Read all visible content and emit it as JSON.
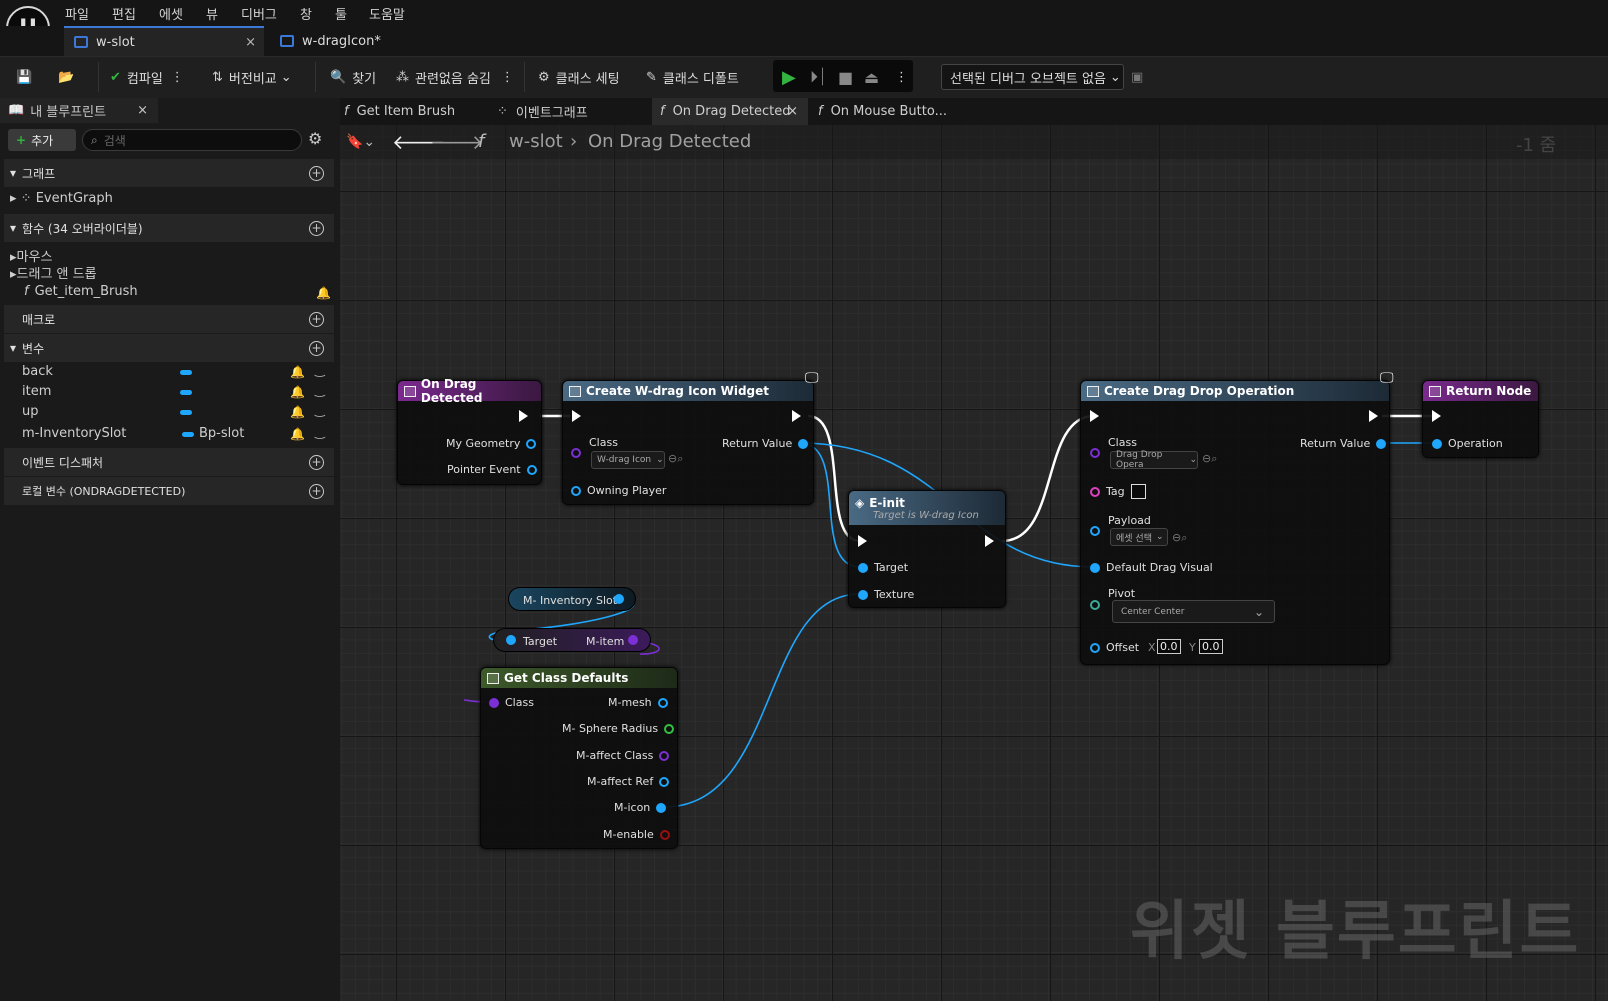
{
  "menu": [
    "파일",
    "편집",
    "에셋",
    "뷰",
    "디버그",
    "창",
    "툴",
    "도움말"
  ],
  "tabs": [
    {
      "label": "w-slot",
      "close": "×"
    },
    {
      "label": "w-dragIcon*",
      "close": "×"
    }
  ],
  "toolbar": {
    "compile": "컴파일",
    "diff": "버전비교",
    "find": "찾기",
    "hide_unrelated": "관련없음 숨김",
    "class_settings": "클래스 세팅",
    "class_defaults": "클래스 디폴트",
    "debug_object": "선택된 디버그 오브젝트 없음"
  },
  "left_panel": {
    "title": "내 블루프린트",
    "add": "추가",
    "search_placeholder": "검색",
    "sections": {
      "graph": "그래프",
      "functions": "함수 (34 오버라이더블)",
      "macros": "매크로",
      "variables": "변수",
      "dispatchers": "이벤트 디스패처",
      "locals": "로컬 변수 (ONDRAGDETECTED)"
    },
    "event_graph": "EventGraph",
    "func_mouse": "마우스",
    "func_dragdrop": "드래그 앤 드롭",
    "func_brush": "Get_item_Brush",
    "variables": [
      {
        "name": "back",
        "type": ""
      },
      {
        "name": "item",
        "type": ""
      },
      {
        "name": "up",
        "type": ""
      },
      {
        "name": "m-InventorySlot",
        "type": "Bp-slot"
      }
    ]
  },
  "graph_tabs": [
    "Get Item Brush",
    "이벤트그래프",
    "On Drag Detected",
    "On Mouse Butto..."
  ],
  "breadcrumb": {
    "root": "w-slot",
    "current": "On Drag Detected",
    "zoom": "-1 줌"
  },
  "nodes": {
    "on_drag": {
      "title": "On Drag Detected",
      "pins": [
        "My Geometry",
        "Pointer Event"
      ]
    },
    "create_widget": {
      "title": "Create W-drag Icon Widget",
      "class_label": "Class",
      "class_value": "W-drag Icon",
      "owning": "Owning Player",
      "ret": "Return Value"
    },
    "einit": {
      "title": "E-init",
      "subtitle": "Target is W-drag Icon",
      "target": "Target",
      "texture": "Texture"
    },
    "inv_slot": {
      "label": "M- Inventory Slot"
    },
    "m_item": {
      "target": "Target",
      "value": "M-item"
    },
    "gcd": {
      "title": "Get Class Defaults",
      "class": "Class",
      "outs": [
        "M-mesh",
        "M- Sphere Radius",
        "M-affect Class",
        "M-affect Ref",
        "M-icon",
        "M-enable"
      ]
    },
    "ddo": {
      "title": "Create Drag Drop Operation",
      "class": "Class",
      "class_value": "Drag Drop Opera",
      "tag": "Tag",
      "payload": "Payload",
      "payload_value": "에셋 선택",
      "visual": "Default Drag Visual",
      "pivot": "Pivot",
      "pivot_value": "Center Center",
      "offset": "Offset",
      "x_label": "X",
      "x_val": "0.0",
      "y_label": "Y",
      "y_val": "0.0",
      "ret": "Return Value"
    },
    "ret": {
      "title": "Return Node",
      "pin": "Operation"
    }
  },
  "watermark": "위젯 블루프린트",
  "colors": {
    "accent": "#1ea7fd",
    "event_head": "#7a2a8e",
    "func_head": "#4a6a84",
    "gcd_head": "#3d5a2a",
    "play": "#33b340"
  }
}
